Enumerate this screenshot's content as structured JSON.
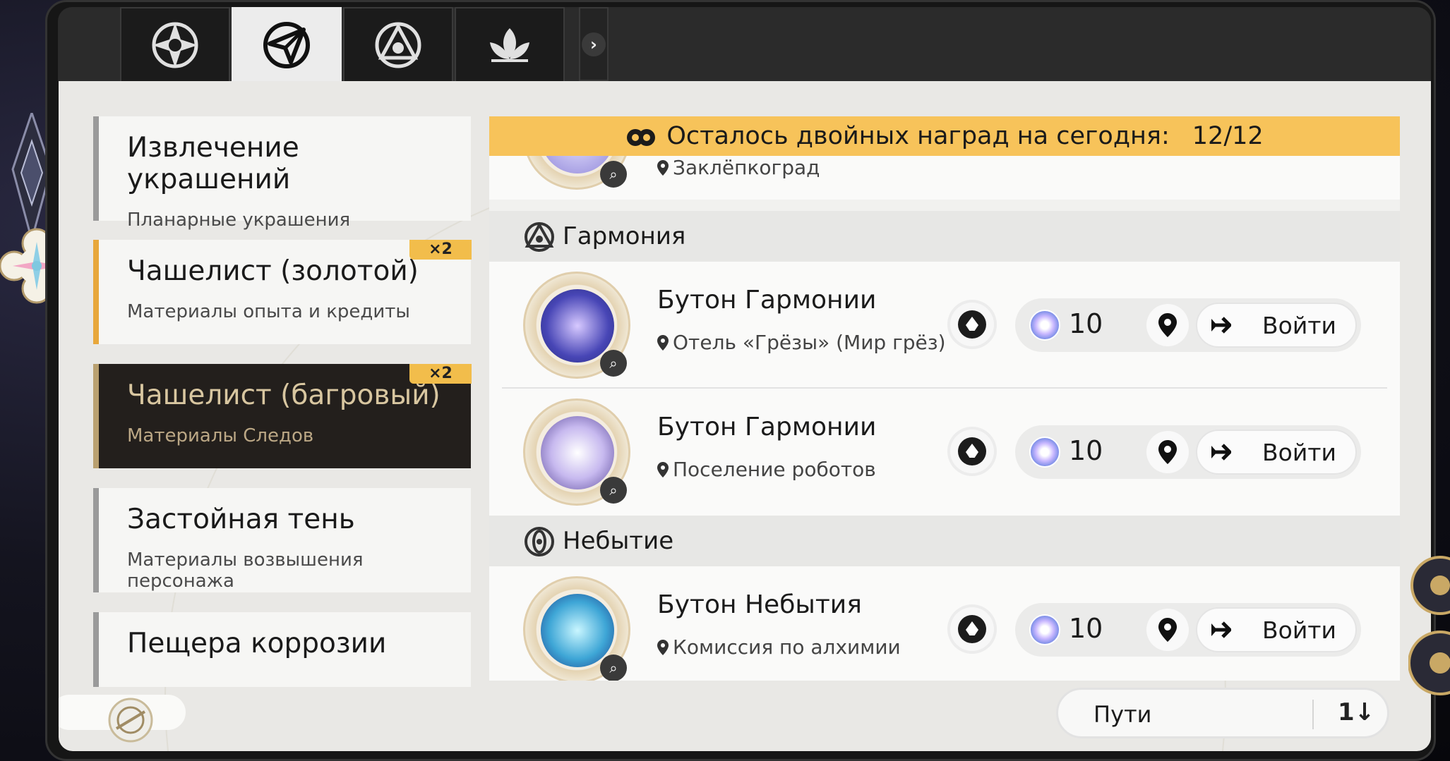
{
  "tabs": [
    {
      "name": "tab-1",
      "icon": "compass-rose-icon"
    },
    {
      "name": "tab-2",
      "icon": "paper-plane-icon",
      "active": true
    },
    {
      "name": "tab-3",
      "icon": "triangle-knot-icon"
    },
    {
      "name": "tab-4",
      "icon": "lotus-icon"
    }
  ],
  "categories": [
    {
      "title": "Извлечение украшений",
      "subtitle": "Планарные украшения",
      "badge": ""
    },
    {
      "title": "Чашелист (золотой)",
      "subtitle": "Материалы опыта и кредиты",
      "badge": "×2"
    },
    {
      "title": "Чашелист (багровый)",
      "subtitle": "Материалы Следов",
      "badge": "×2",
      "selected": true
    },
    {
      "title": "Застойная тень",
      "subtitle": "Материалы возвышения персонажа",
      "badge": ""
    },
    {
      "title": "Пещера коррозии",
      "subtitle": "",
      "badge": ""
    }
  ],
  "banner": {
    "label": "Осталось двойных наград на сегодня:",
    "count": "12/12"
  },
  "partial_row": {
    "location": "Заклёпкоград"
  },
  "groups": [
    {
      "name": "Гармония",
      "items": [
        {
          "title": "Бутон Гармонии",
          "location": "Отель «Грёзы» (Мир грёз)",
          "cost": "10",
          "action": "Войти"
        },
        {
          "title": "Бутон Гармонии",
          "location": "Поселение роботов",
          "cost": "10",
          "action": "Войти"
        }
      ]
    },
    {
      "name": "Небытие",
      "items": [
        {
          "title": "Бутон Небытия",
          "location": "Комиссия по алхимии",
          "cost": "10",
          "action": "Войти"
        }
      ]
    }
  ],
  "sort": {
    "label": "Пути",
    "icon": "sort-icon",
    "icon_text": "1↓"
  },
  "colors": {
    "accent_gold": "#f7c35a",
    "selected_bg": "#231f1c",
    "panel_bg": "#e9e8e5"
  }
}
